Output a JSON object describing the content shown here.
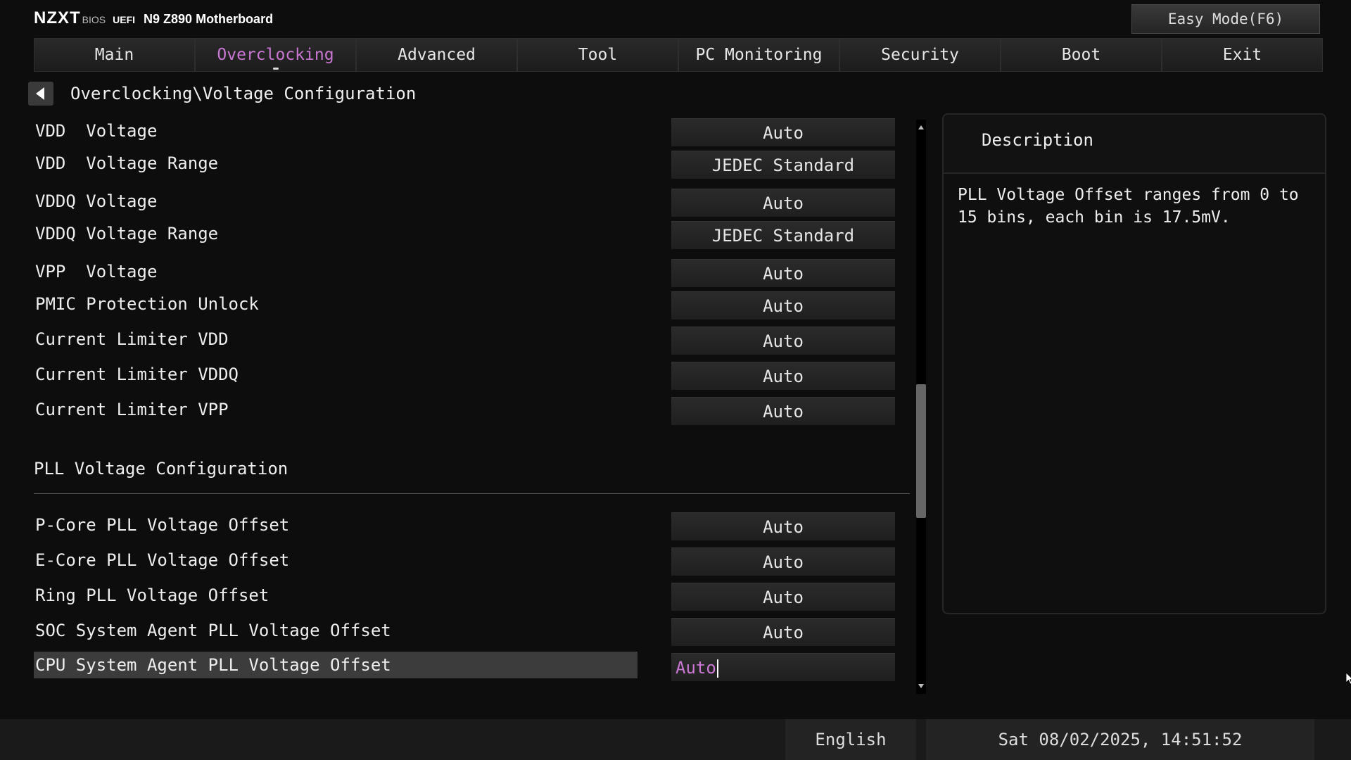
{
  "header": {
    "brand": "NZXT",
    "bios": "BIOS",
    "uefi": "UEFI",
    "model": "N9 Z890 Motherboard",
    "easy_mode": "Easy Mode(F6)"
  },
  "tabs": [
    {
      "label": "Main",
      "active": false
    },
    {
      "label": "Overclocking",
      "active": true
    },
    {
      "label": "Advanced",
      "active": false
    },
    {
      "label": "Tool",
      "active": false
    },
    {
      "label": "PC Monitoring",
      "active": false
    },
    {
      "label": "Security",
      "active": false
    },
    {
      "label": "Boot",
      "active": false
    },
    {
      "label": "Exit",
      "active": false
    }
  ],
  "accent_color": "#c977d2",
  "breadcrumb": "Overclocking\\Voltage Configuration",
  "settings": [
    {
      "label": "VDD  Voltage",
      "value": "Auto"
    },
    {
      "label": "VDD  Voltage Range",
      "value": "JEDEC Standard"
    },
    {
      "label": "VDDQ Voltage",
      "value": "Auto"
    },
    {
      "label": "VDDQ Voltage Range",
      "value": "JEDEC Standard"
    },
    {
      "label": "VPP  Voltage",
      "value": "Auto"
    },
    {
      "label": "PMIC Protection Unlock",
      "value": "Auto"
    },
    {
      "label": "Current Limiter VDD",
      "value": "Auto"
    },
    {
      "label": "Current Limiter VDDQ",
      "value": "Auto"
    },
    {
      "label": "Current Limiter VPP",
      "value": "Auto"
    }
  ],
  "section_title": "PLL Voltage Configuration",
  "pll_settings": [
    {
      "label": "P-Core PLL Voltage Offset",
      "value": "Auto"
    },
    {
      "label": "E-Core PLL Voltage Offset",
      "value": "Auto"
    },
    {
      "label": "Ring PLL Voltage Offset",
      "value": "Auto"
    },
    {
      "label": "SOC System Agent PLL Voltage Offset",
      "value": "Auto"
    },
    {
      "label": "CPU System Agent PLL Voltage Offset",
      "value": "Auto",
      "selected": true
    }
  ],
  "description": {
    "title": "Description",
    "text": "PLL Voltage Offset ranges from 0 to 15 bins, each bin is 17.5mV."
  },
  "footer": {
    "language": "English",
    "datetime": "Sat 08/02/2025, 14:51:52"
  }
}
